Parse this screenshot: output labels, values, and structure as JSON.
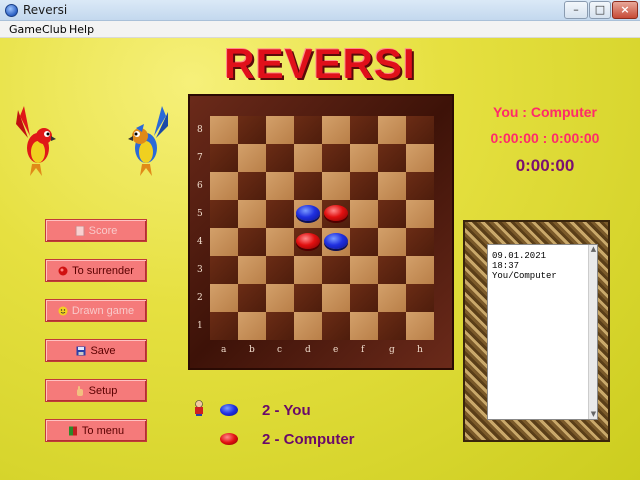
{
  "window": {
    "title": "Reversi",
    "min_label": "–",
    "max_label": "□",
    "close_label": "×"
  },
  "menu": [
    "Game",
    "Club",
    "Help"
  ],
  "logo": "REVERSI",
  "buttons": [
    {
      "label": "Score",
      "icon": "book-icon",
      "enabled": false
    },
    {
      "label": "To surrender",
      "icon": "surrender-icon",
      "enabled": true
    },
    {
      "label": "Drawn game",
      "icon": "smiley-icon",
      "enabled": false
    },
    {
      "label": "Save",
      "icon": "floppy-icon",
      "enabled": true
    },
    {
      "label": "Setup",
      "icon": "hand-icon",
      "enabled": true
    },
    {
      "label": "To menu",
      "icon": "menu-icon",
      "enabled": true
    }
  ],
  "info": {
    "players": "You : Computer",
    "clocks": "0:00:00 : 0:00:00",
    "elapsed": "0:00:00"
  },
  "log": [
    "09.01.2021",
    "18:37",
    "You/Computer"
  ],
  "board": {
    "ranks": [
      "8",
      "7",
      "6",
      "5",
      "4",
      "3",
      "2",
      "1"
    ],
    "files": [
      "a",
      "b",
      "c",
      "d",
      "e",
      "f",
      "g",
      "h"
    ],
    "discs": [
      {
        "square": "d5",
        "color": "blue"
      },
      {
        "square": "e5",
        "color": "red"
      },
      {
        "square": "d4",
        "color": "red"
      },
      {
        "square": "e4",
        "color": "blue"
      }
    ]
  },
  "score": [
    {
      "text": "2 - You",
      "color": "blue"
    },
    {
      "text": "2 - Computer",
      "color": "red"
    }
  ],
  "colors": {
    "blue_disc": "#1f2fe0",
    "red_disc": "#e21010",
    "button": "#f57a7a",
    "background": "#e6e040"
  }
}
